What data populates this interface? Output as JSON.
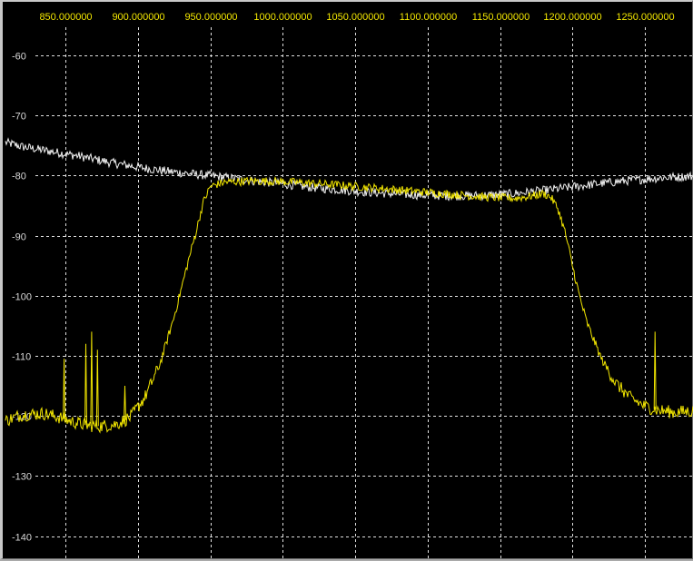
{
  "chart_data": {
    "type": "line",
    "title": "",
    "xlabel": "",
    "ylabel": "",
    "xlim": [
      808.5,
      1284.5
    ],
    "ylim": [
      -144,
      -51.4
    ],
    "x_ticks": [
      850,
      900,
      950,
      1000,
      1050,
      1100,
      1150,
      1200,
      1250
    ],
    "x_tick_labels": [
      "850.000000",
      "900.000000",
      "950.000000",
      "1000.000000",
      "1050.000000",
      "1100.000000",
      "1150.000000",
      "1200.000000",
      "1250.000000"
    ],
    "y_ticks": [
      -60,
      -70,
      -80,
      -90,
      -100,
      -110,
      -120,
      -130,
      -140
    ],
    "y_tick_labels": [
      "-60",
      "-70",
      "-80",
      "-90",
      "-100",
      "-110",
      "-120",
      "-130",
      "-140"
    ],
    "grid": true,
    "background": "#000000",
    "grid_color": "#e0e0e0",
    "series": [
      {
        "color": "#f2f2f2",
        "x": [
          808.5,
          820,
          840,
          860,
          880,
          900,
          920,
          940,
          960,
          980,
          1000,
          1020,
          1040,
          1060,
          1080,
          1100,
          1120,
          1140,
          1160,
          1180,
          1200,
          1220,
          1240,
          1260,
          1284.5
        ],
        "y": [
          -74.5,
          -75.2,
          -76.0,
          -76.8,
          -77.8,
          -78.6,
          -79.3,
          -79.8,
          -80.3,
          -80.9,
          -81.4,
          -82.0,
          -82.4,
          -82.8,
          -83.1,
          -83.3,
          -83.4,
          -83.3,
          -83.0,
          -82.5,
          -81.9,
          -81.3,
          -80.8,
          -80.4,
          -80.1
        ]
      },
      {
        "color": "#f2e600",
        "x": [
          808.5,
          820,
          835,
          845,
          855,
          865,
          875,
          885,
          895,
          905,
          915,
          925,
          935,
          940,
          945,
          950,
          960,
          980,
          1000,
          1020,
          1040,
          1060,
          1080,
          1100,
          1120,
          1140,
          1160,
          1170,
          1180,
          1185,
          1190,
          1195,
          1200,
          1205,
          1210,
          1220,
          1230,
          1240,
          1250,
          1260,
          1270,
          1284.5
        ],
        "y": [
          -120.8,
          -119.8,
          -119.6,
          -120.2,
          -121.0,
          -121.6,
          -121.7,
          -121.4,
          -120.2,
          -116.8,
          -111.5,
          -103.5,
          -94.0,
          -89.5,
          -84.5,
          -81.8,
          -81.1,
          -80.9,
          -81.0,
          -81.3,
          -81.6,
          -82.0,
          -82.4,
          -82.8,
          -83.2,
          -83.6,
          -83.8,
          -83.5,
          -83.0,
          -83.6,
          -85.5,
          -89.5,
          -95.0,
          -100.2,
          -104.5,
          -110.5,
          -114.6,
          -117.0,
          -118.4,
          -119.1,
          -119.4,
          -119.2
        ]
      }
    ],
    "spikes": [
      {
        "x": 849,
        "y": -110.5
      },
      {
        "x": 864,
        "y": -108.0
      },
      {
        "x": 868,
        "y": -106.0
      },
      {
        "x": 872,
        "y": -109.0
      },
      {
        "x": 891,
        "y": -115.0
      },
      {
        "x": 1257,
        "y": -106.0
      }
    ]
  }
}
